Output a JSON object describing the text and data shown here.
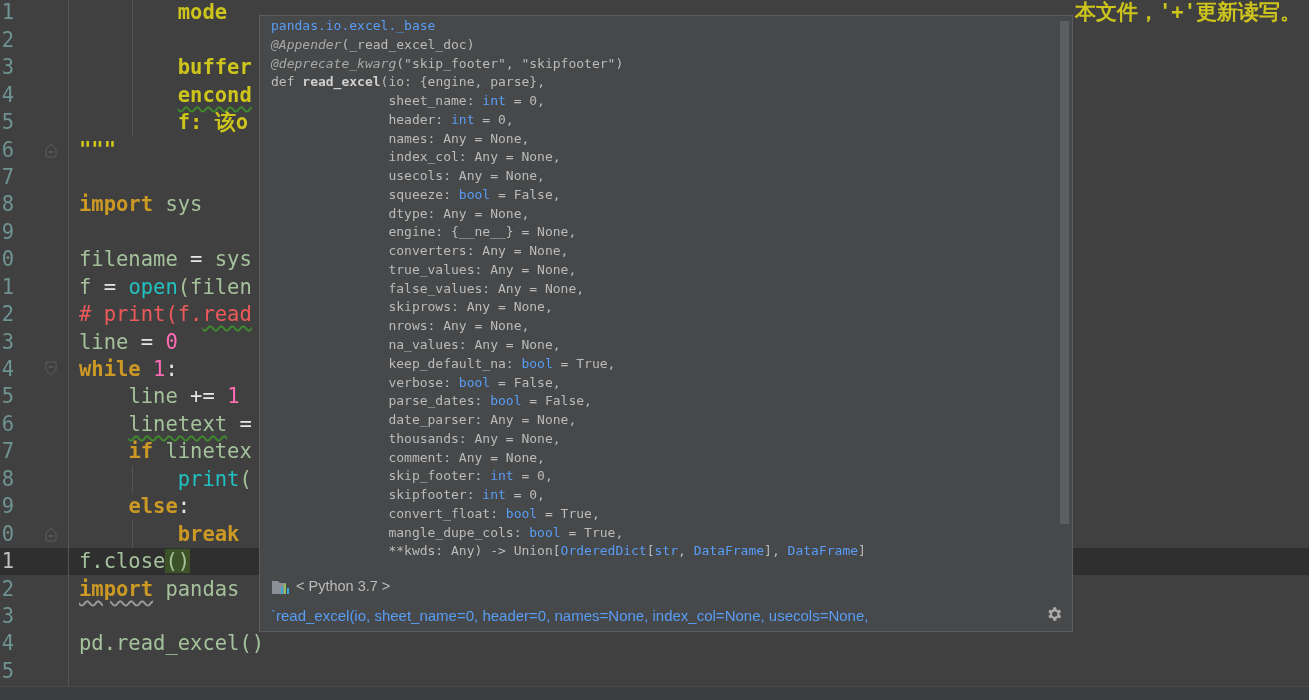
{
  "editor": {
    "lines": [
      {
        "number": "1",
        "current": false,
        "tokens": [
          {
            "text": "        mode",
            "kind": "doc"
          }
        ],
        "tail": {
          "text": "本文件，'+'更新读写。",
          "kind": "doc"
        }
      },
      {
        "number": "2",
        "current": false
      },
      {
        "number": "3",
        "current": false,
        "tokens": [
          {
            "text": "        buffer",
            "kind": "doc"
          }
        ]
      },
      {
        "number": "4",
        "current": false,
        "tokens": [
          {
            "text": "        encond",
            "kind": "doc",
            "warning": true
          }
        ]
      },
      {
        "number": "5",
        "current": false,
        "tokens": [
          {
            "text": "        f: 该o",
            "kind": "doc"
          }
        ]
      },
      {
        "number": "6",
        "current": false,
        "fold_end": true,
        "tokens": [
          {
            "text": "\"\"\"",
            "kind": "doc"
          }
        ]
      },
      {
        "number": "7",
        "current": false
      },
      {
        "number": "8",
        "current": false,
        "tokens": [
          {
            "text": "import",
            "kind": "kw"
          },
          {
            "text": " sys",
            "kind": "id"
          }
        ]
      },
      {
        "number": "9",
        "current": false
      },
      {
        "number": "0",
        "current": false,
        "tokens": [
          {
            "text": "filename",
            "kind": "id"
          },
          {
            "text": " = ",
            "kind": "op"
          },
          {
            "text": "sys",
            "kind": "id"
          }
        ]
      },
      {
        "number": "1",
        "current": false,
        "tokens": [
          {
            "text": "f",
            "kind": "id"
          },
          {
            "text": " = ",
            "kind": "op"
          },
          {
            "text": "open",
            "kind": "builtin"
          },
          {
            "text": "(filen",
            "kind": "id"
          }
        ]
      },
      {
        "number": "2",
        "current": false,
        "tokens": [
          {
            "text": "# print(f.",
            "kind": "comment"
          },
          {
            "text": "read",
            "kind": "comment",
            "warning": true
          }
        ]
      },
      {
        "number": "3",
        "current": false,
        "tokens": [
          {
            "text": "line",
            "kind": "id"
          },
          {
            "text": " = ",
            "kind": "op"
          },
          {
            "text": "0",
            "kind": "num"
          }
        ]
      },
      {
        "number": "4",
        "current": false,
        "fold_start": true,
        "tokens": [
          {
            "text": "while",
            "kind": "kw"
          },
          {
            "text": " 1",
            "kind": "num"
          },
          {
            "text": ":",
            "kind": "op"
          }
        ]
      },
      {
        "number": "5",
        "current": false,
        "tokens": [
          {
            "text": "    line",
            "kind": "id"
          },
          {
            "text": " += ",
            "kind": "op"
          },
          {
            "text": "1",
            "kind": "num"
          }
        ]
      },
      {
        "number": "6",
        "current": false,
        "tokens": [
          {
            "text": "    linetext",
            "kind": "id",
            "warning": true
          },
          {
            "text": " =",
            "kind": "op"
          }
        ]
      },
      {
        "number": "7",
        "current": false,
        "tokens": [
          {
            "text": "    if",
            "kind": "kw"
          },
          {
            "text": " linetex",
            "kind": "id"
          }
        ]
      },
      {
        "number": "8",
        "current": false,
        "tokens": [
          {
            "text": "        print",
            "kind": "builtin"
          },
          {
            "text": "(",
            "kind": "id"
          }
        ]
      },
      {
        "number": "9",
        "current": false,
        "tokens": [
          {
            "text": "    else",
            "kind": "kw"
          },
          {
            "text": ":",
            "kind": "op"
          }
        ]
      },
      {
        "number": "0",
        "current": false,
        "fold_end": true,
        "tokens": [
          {
            "text": "        break",
            "kind": "kw"
          }
        ]
      },
      {
        "number": "1",
        "current": true,
        "tokens": [
          {
            "text": "f.close",
            "kind": "id"
          },
          {
            "text": "()",
            "kind": "paren_match"
          }
        ]
      },
      {
        "number": "2",
        "current": false,
        "tokens": [
          {
            "text": "import",
            "kind": "kw",
            "typo": true
          },
          {
            "text": " pandas",
            "kind": "id"
          }
        ]
      },
      {
        "number": "3",
        "current": false
      },
      {
        "number": "4",
        "current": false,
        "tokens": [
          {
            "text": "pd.read_excel()",
            "kind": "id"
          }
        ]
      },
      {
        "number": "5",
        "current": false
      }
    ]
  },
  "popup": {
    "signature": [
      [
        {
          "text": "pandas.io.excel._base",
          "kind": "module"
        }
      ],
      [
        {
          "text": "@Appender",
          "kind": "deco"
        },
        {
          "text": "(_read_excel_doc)",
          "kind": "plain"
        }
      ],
      [
        {
          "text": "@deprecate_kwarg",
          "kind": "deco"
        },
        {
          "text": "(\"skip_footer\", \"skipfooter\")",
          "kind": "plain"
        }
      ],
      [
        {
          "text": "def ",
          "kind": "plain"
        },
        {
          "text": "read_excel",
          "kind": "bold"
        },
        {
          "text": "(io: {engine, parse},",
          "kind": "plain"
        }
      ],
      [
        {
          "text": "               sheet_name: ",
          "kind": "plain"
        },
        {
          "text": "int",
          "kind": "type"
        },
        {
          "text": " = 0,",
          "kind": "plain"
        }
      ],
      [
        {
          "text": "               header: ",
          "kind": "plain"
        },
        {
          "text": "int",
          "kind": "type"
        },
        {
          "text": " = 0,",
          "kind": "plain"
        }
      ],
      [
        {
          "text": "               names: Any = None,",
          "kind": "plain"
        }
      ],
      [
        {
          "text": "               index_col: Any = None,",
          "kind": "plain"
        }
      ],
      [
        {
          "text": "               usecols: Any = None,",
          "kind": "plain"
        }
      ],
      [
        {
          "text": "               squeeze: ",
          "kind": "plain"
        },
        {
          "text": "bool",
          "kind": "type"
        },
        {
          "text": " = False,",
          "kind": "plain"
        }
      ],
      [
        {
          "text": "               dtype: Any = None,",
          "kind": "plain"
        }
      ],
      [
        {
          "text": "               engine: {__ne__} = None,",
          "kind": "plain"
        }
      ],
      [
        {
          "text": "               converters: Any = None,",
          "kind": "plain"
        }
      ],
      [
        {
          "text": "               true_values: Any = None,",
          "kind": "plain"
        }
      ],
      [
        {
          "text": "               false_values: Any = None,",
          "kind": "plain"
        }
      ],
      [
        {
          "text": "               skiprows: Any = None,",
          "kind": "plain"
        }
      ],
      [
        {
          "text": "               nrows: Any = None,",
          "kind": "plain"
        }
      ],
      [
        {
          "text": "               na_values: Any = None,",
          "kind": "plain"
        }
      ],
      [
        {
          "text": "               keep_default_na: ",
          "kind": "plain"
        },
        {
          "text": "bool",
          "kind": "type"
        },
        {
          "text": " = True,",
          "kind": "plain"
        }
      ],
      [
        {
          "text": "               verbose: ",
          "kind": "plain"
        },
        {
          "text": "bool",
          "kind": "type"
        },
        {
          "text": " = False,",
          "kind": "plain"
        }
      ],
      [
        {
          "text": "               parse_dates: ",
          "kind": "plain"
        },
        {
          "text": "bool",
          "kind": "type"
        },
        {
          "text": " = False,",
          "kind": "plain"
        }
      ],
      [
        {
          "text": "               date_parser: Any = None,",
          "kind": "plain"
        }
      ],
      [
        {
          "text": "               thousands: Any = None,",
          "kind": "plain"
        }
      ],
      [
        {
          "text": "               comment: Any = None,",
          "kind": "plain"
        }
      ],
      [
        {
          "text": "               skip_footer: ",
          "kind": "plain"
        },
        {
          "text": "int",
          "kind": "type"
        },
        {
          "text": " = 0,",
          "kind": "plain"
        }
      ],
      [
        {
          "text": "               skipfooter: ",
          "kind": "plain"
        },
        {
          "text": "int",
          "kind": "type"
        },
        {
          "text": " = 0,",
          "kind": "plain"
        }
      ],
      [
        {
          "text": "               convert_float: ",
          "kind": "plain"
        },
        {
          "text": "bool",
          "kind": "type"
        },
        {
          "text": " = True,",
          "kind": "plain"
        }
      ],
      [
        {
          "text": "               mangle_dupe_cols: ",
          "kind": "plain"
        },
        {
          "text": "bool",
          "kind": "type"
        },
        {
          "text": " = True,",
          "kind": "plain"
        }
      ],
      [
        {
          "text": "               **kwds: Any) -> Union[",
          "kind": "plain"
        },
        {
          "text": "OrderedDict",
          "kind": "type"
        },
        {
          "text": "[",
          "kind": "plain"
        },
        {
          "text": "str",
          "kind": "type"
        },
        {
          "text": ", ",
          "kind": "plain"
        },
        {
          "text": "DataFrame",
          "kind": "type"
        },
        {
          "text": "], ",
          "kind": "plain"
        },
        {
          "text": "DataFrame",
          "kind": "type"
        },
        {
          "text": "]",
          "kind": "plain"
        }
      ]
    ],
    "source": "< Python 3.7 >",
    "doc_preview": "`read_excel(io, sheet_name=0, header=0, names=None, index_col=None, usecols=None,"
  }
}
